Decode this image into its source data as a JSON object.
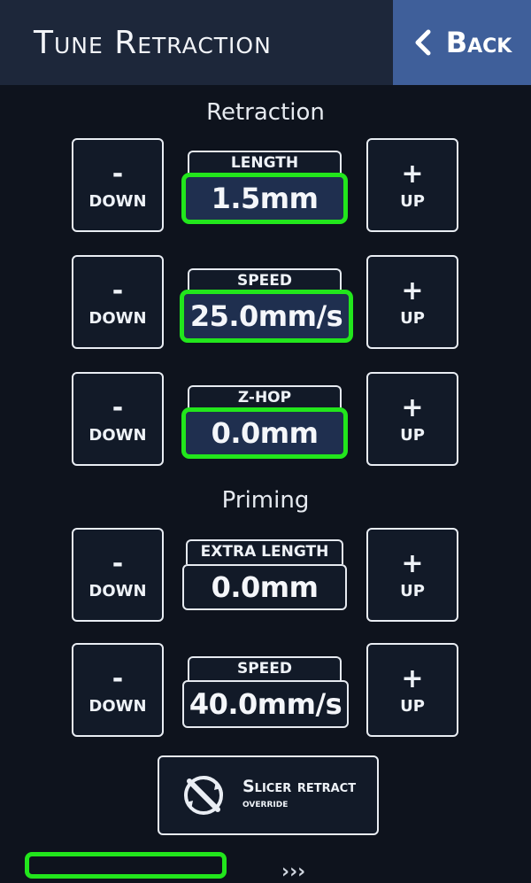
{
  "header": {
    "title": "Tune Retraction",
    "back_label": "Back"
  },
  "sections": {
    "retraction_label": "Retraction",
    "priming_label": "Priming"
  },
  "buttons": {
    "down_symbol": "-",
    "down_label": "DOWN",
    "up_symbol": "+",
    "up_label": "UP"
  },
  "rows": [
    {
      "label": "LENGTH",
      "value": "1.5mm"
    },
    {
      "label": "SPEED",
      "value": "25.0mm/s"
    },
    {
      "label": "Z-HOP",
      "value": "0.0mm"
    },
    {
      "label": "EXTRA LENGTH",
      "value": "0.0mm"
    },
    {
      "label": "SPEED",
      "value": "40.0mm/s"
    }
  ],
  "override": {
    "line1": "Slicer retract",
    "line2": "override"
  },
  "highlight_color": "#22e61c"
}
